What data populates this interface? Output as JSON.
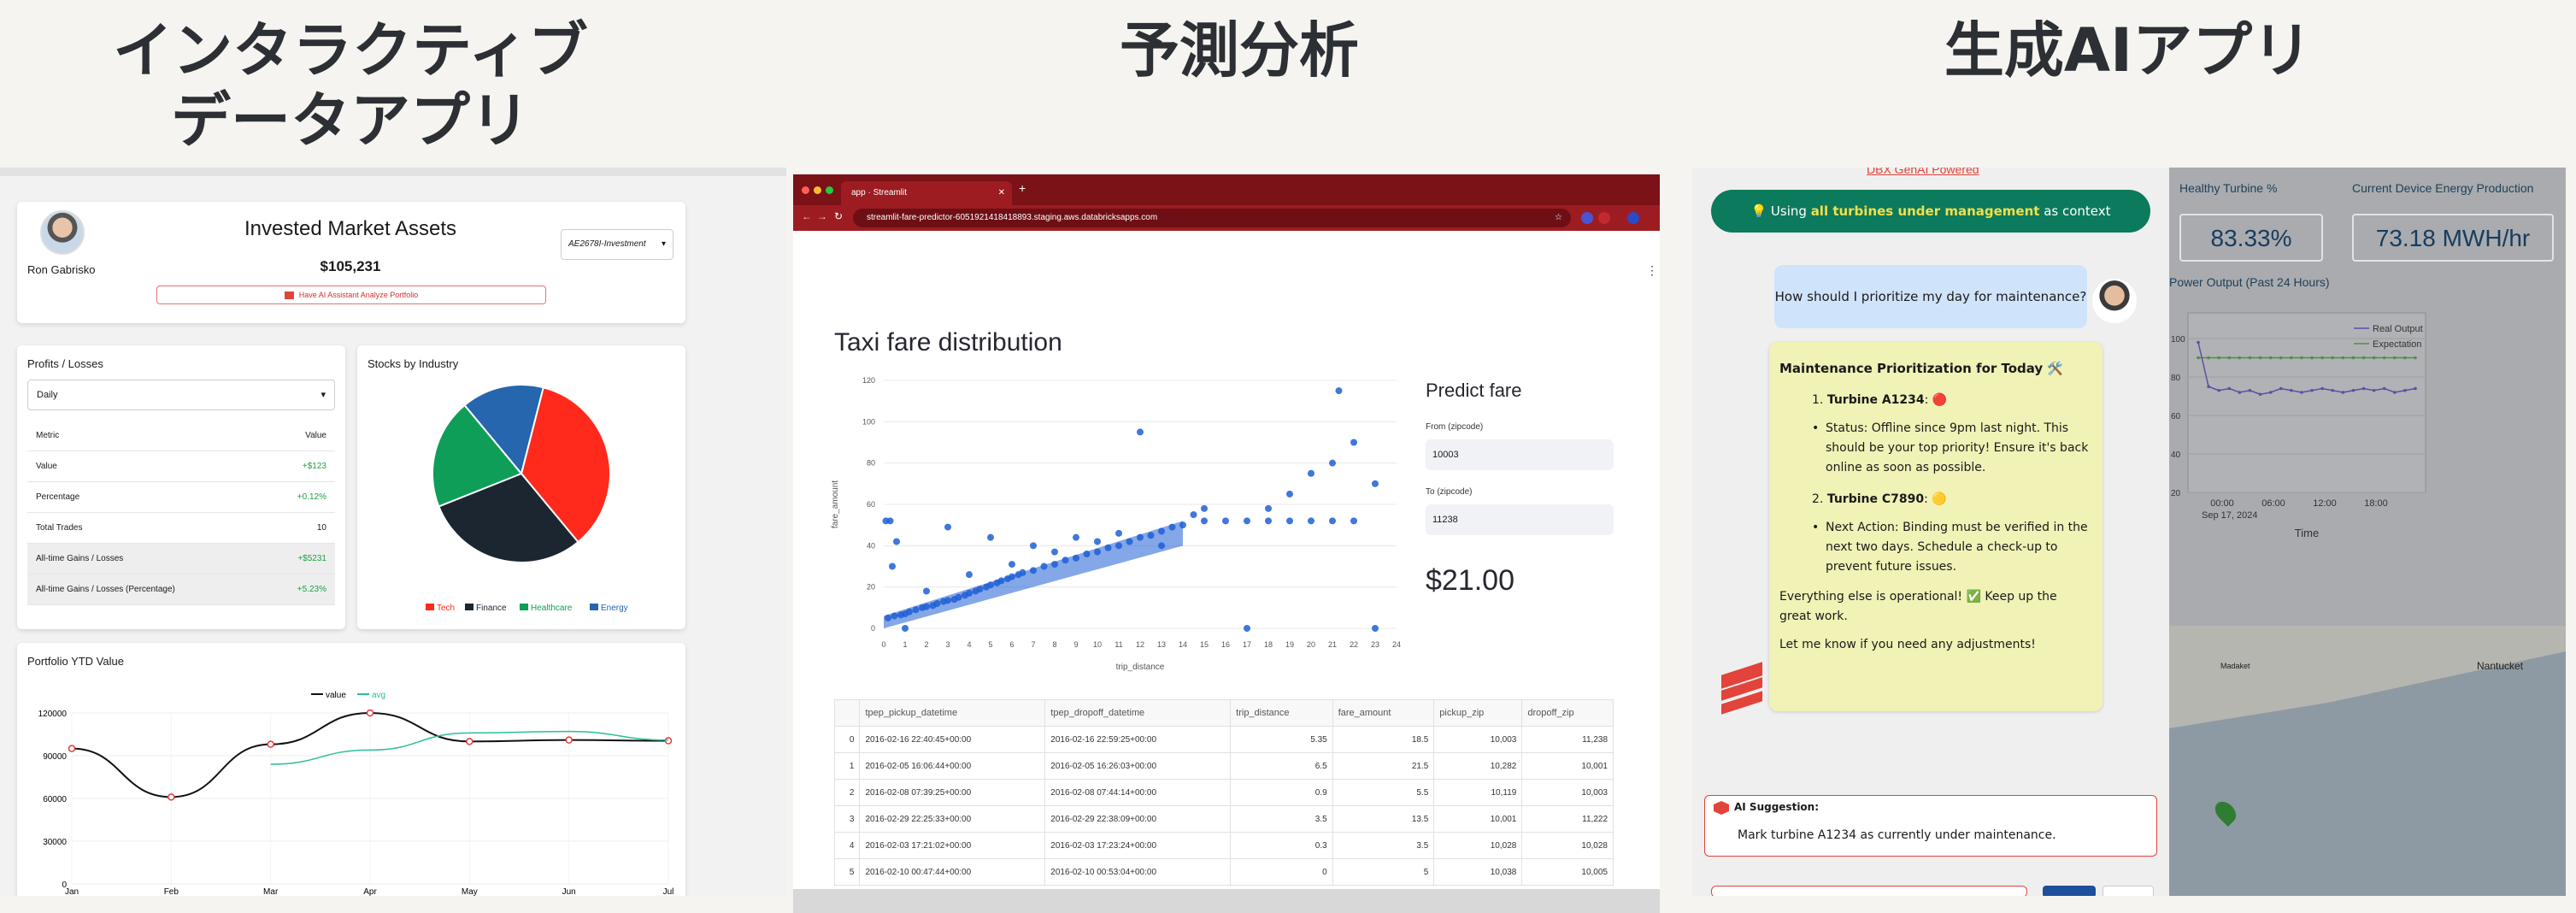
{
  "headers": {
    "col1_line1": "インタラクティブ",
    "col1_line2": "データアプリ",
    "col2": "予測分析",
    "col3": "生成AIアプリ"
  },
  "portfolio": {
    "user_name": "Ron Gabrisko",
    "title": "Invested Market Assets",
    "total": "$105,231",
    "account_select": "AE2678I-Investment",
    "ai_button": "Have AI Assistant Analyze Portfolio",
    "pl_title": "Profits / Losses",
    "period_select": "Daily",
    "metric_header": "Metric",
    "value_header": "Value",
    "rows": [
      {
        "metric": "Value",
        "value": "+$123"
      },
      {
        "metric": "Percentage",
        "value": "+0.12%"
      },
      {
        "metric": "Total Trades",
        "value": "10"
      },
      {
        "metric": "All-time Gains / Losses",
        "value": "+$5231"
      },
      {
        "metric": "All-time Gains / Losses (Percentage)",
        "value": "+5.23%"
      }
    ],
    "pie_title": "Stocks by Industry",
    "ytd_title": "Portfolio YTD Value"
  },
  "pie_chart": {
    "type": "pie",
    "slices": [
      {
        "name": "Tech",
        "value": 35,
        "color": "#ff2a1c"
      },
      {
        "name": "Finance",
        "value": 30,
        "color": "#1c2630"
      },
      {
        "name": "Healthcare",
        "value": 20,
        "color": "#0f9e58"
      },
      {
        "name": "Energy",
        "value": 15,
        "color": "#2566ae"
      }
    ]
  },
  "line_chart": {
    "type": "line",
    "legend": [
      "value",
      "avg"
    ],
    "categories": [
      "Jan",
      "Feb",
      "Mar",
      "Apr",
      "May",
      "Jun",
      "Jul"
    ],
    "yticks": [
      "120000",
      "90000",
      "60000",
      "30000",
      "0"
    ],
    "ylim": [
      0,
      120000
    ],
    "series": [
      {
        "name": "value",
        "values": [
          95000,
          61000,
          98000,
          120000,
          100000,
          101000,
          100500
        ],
        "color": "#111111"
      },
      {
        "name": "avg",
        "values": [
          null,
          null,
          84000,
          94000,
          106000,
          107000,
          101000
        ],
        "color": "#2bbf9a"
      }
    ]
  },
  "browser": {
    "tab_title": "app · Streamlit",
    "url": "streamlit-fare-predictor-6051921418418893.staging.aws.databricksapps.com",
    "menu": "⋮"
  },
  "streamlit": {
    "heading": "Taxi fare distribution",
    "predict_title": "Predict fare",
    "from_label": "From (zipcode)",
    "from_value": "10003",
    "to_label": "To (zipcode)",
    "to_value": "11238",
    "prediction": "$21.00"
  },
  "chart_data": {
    "type": "scatter",
    "xlabel": "trip_distance",
    "ylabel": "fare_amount",
    "xlim": [
      0,
      24
    ],
    "ylim": [
      0,
      120
    ],
    "xticks": [
      0,
      1,
      2,
      3,
      4,
      5,
      6,
      7,
      8,
      9,
      10,
      11,
      12,
      13,
      14,
      15,
      16,
      17,
      18,
      19,
      20,
      21,
      22,
      23,
      24
    ],
    "yticks": [
      0,
      20,
      40,
      60,
      80,
      100,
      120
    ],
    "points": [
      [
        0.2,
        5
      ],
      [
        0.5,
        6
      ],
      [
        0.8,
        6.5
      ],
      [
        1,
        7
      ],
      [
        1.2,
        8
      ],
      [
        1.5,
        9
      ],
      [
        1.8,
        10
      ],
      [
        2,
        10.5
      ],
      [
        2.3,
        11
      ],
      [
        2.5,
        12
      ],
      [
        2.8,
        13
      ],
      [
        3,
        13.5
      ],
      [
        3.3,
        14
      ],
      [
        3.5,
        15
      ],
      [
        3.8,
        16
      ],
      [
        4,
        17
      ],
      [
        4.3,
        18
      ],
      [
        4.5,
        19
      ],
      [
        4.8,
        20
      ],
      [
        5,
        21
      ],
      [
        5.3,
        22
      ],
      [
        5.5,
        23
      ],
      [
        5.8,
        24
      ],
      [
        6,
        25
      ],
      [
        6.3,
        26
      ],
      [
        6.5,
        27
      ],
      [
        7,
        28
      ],
      [
        7.5,
        30
      ],
      [
        8,
        31
      ],
      [
        8.5,
        33
      ],
      [
        9,
        34
      ],
      [
        9.5,
        36
      ],
      [
        10,
        37
      ],
      [
        10.5,
        39
      ],
      [
        11,
        40
      ],
      [
        11.5,
        42
      ],
      [
        12,
        44
      ],
      [
        12.5,
        45
      ],
      [
        13,
        47
      ],
      [
        13.5,
        49
      ],
      [
        14,
        50
      ],
      [
        15,
        52
      ],
      [
        16,
        52
      ],
      [
        17,
        52
      ],
      [
        18,
        52
      ],
      [
        19,
        52
      ],
      [
        20,
        52
      ],
      [
        21,
        52
      ],
      [
        22,
        52
      ],
      [
        0.1,
        52
      ],
      [
        0.3,
        52
      ],
      [
        3,
        49
      ],
      [
        5,
        44
      ],
      [
        7,
        40
      ],
      [
        9,
        44
      ],
      [
        11,
        46
      ],
      [
        12,
        95
      ],
      [
        19,
        65
      ],
      [
        20,
        75
      ],
      [
        21,
        80
      ],
      [
        21.3,
        115
      ],
      [
        22,
        90
      ],
      [
        23,
        70
      ],
      [
        17,
        0
      ],
      [
        23,
        0
      ],
      [
        1,
        0
      ],
      [
        0.4,
        30
      ],
      [
        0.6,
        42
      ],
      [
        2,
        18
      ],
      [
        4,
        26
      ],
      [
        6,
        31
      ],
      [
        8,
        37
      ],
      [
        10,
        42
      ],
      [
        13,
        40
      ],
      [
        14.5,
        55
      ],
      [
        15,
        58
      ],
      [
        18,
        58
      ]
    ]
  },
  "table": {
    "columns": [
      "",
      "tpep_pickup_datetime",
      "tpep_dropoff_datetime",
      "trip_distance",
      "fare_amount",
      "pickup_zip",
      "dropoff_zip"
    ],
    "rows": [
      [
        "0",
        "2016-02-16 22:40:45+00:00",
        "2016-02-16 22:59:25+00:00",
        "5.35",
        "18.5",
        "10,003",
        "11,238"
      ],
      [
        "1",
        "2016-02-05 16:06:44+00:00",
        "2016-02-05 16:26:03+00:00",
        "6.5",
        "21.5",
        "10,282",
        "10,001"
      ],
      [
        "2",
        "2016-02-08 07:39:25+00:00",
        "2016-02-08 07:44:14+00:00",
        "0.9",
        "5.5",
        "10,119",
        "10,003"
      ],
      [
        "3",
        "2016-02-29 22:25:33+00:00",
        "2016-02-29 22:38:09+00:00",
        "3.5",
        "13.5",
        "10,001",
        "11,222"
      ],
      [
        "4",
        "2016-02-03 17:21:02+00:00",
        "2016-02-03 17:23:24+00:00",
        "0.3",
        "3.5",
        "10,028",
        "10,028"
      ],
      [
        "5",
        "2016-02-10 00:47:44+00:00",
        "2016-02-10 00:53:04+00:00",
        "0",
        "5",
        "10,038",
        "10,005"
      ]
    ]
  },
  "genai": {
    "top_link": "DBX GenAI Powered",
    "context_prefix": "Using ",
    "context_highlight": "all turbines under management",
    "context_suffix": " as context",
    "user_question": "How should I prioritize my day for maintenance?",
    "answer_title": "Maintenance Prioritization for Today 🛠️",
    "item1_title": "Turbine A1234",
    "item1_icon": "🔴",
    "item1_detail": "Status: Offline since 9pm last night. This should be your top priority! Ensure it's back online as soon as possible.",
    "item2_title": "Turbine C7890",
    "item2_icon": "🟡",
    "item2_detail": "Next Action: Binding must be verified in the next two days. Schedule a check-up to prevent future issues.",
    "closing1": "Everything else is operational! ✅ Keep up the great work.",
    "closing2": "Let me know if you need any adjustments!",
    "suggestion_label": "AI Suggestion:",
    "suggestion_text": "Mark turbine A1234 as currently under maintenance."
  },
  "dashboard": {
    "metric1_label": "Healthy Turbine %",
    "metric1_value": "83.33%",
    "metric2_label": "Current Device Energy Production",
    "metric2_value": "73.18 MWH/hr",
    "chart_title": "Power Output (Past 24 Hours)",
    "legend": [
      "Real Output",
      "Expectation"
    ],
    "yticks": [
      "100",
      "80",
      "60",
      "40",
      "20"
    ],
    "xticks": [
      "00:00",
      "06:00",
      "12:00",
      "18:00"
    ],
    "date_label": "Sep 17, 2024",
    "x_label": "Time",
    "real": [
      98,
      75,
      73,
      74,
      72,
      73,
      71,
      72,
      74,
      73,
      72,
      73,
      74,
      73,
      72,
      73,
      74,
      73,
      74,
      72,
      73,
      74
    ],
    "expected": [
      90,
      90,
      90,
      90,
      90,
      90,
      90,
      90,
      90,
      90,
      90,
      90,
      90,
      90,
      90,
      90,
      90,
      90,
      90,
      90,
      90,
      90
    ],
    "map_label1": "Nantucket",
    "map_label2": "Madaket"
  }
}
